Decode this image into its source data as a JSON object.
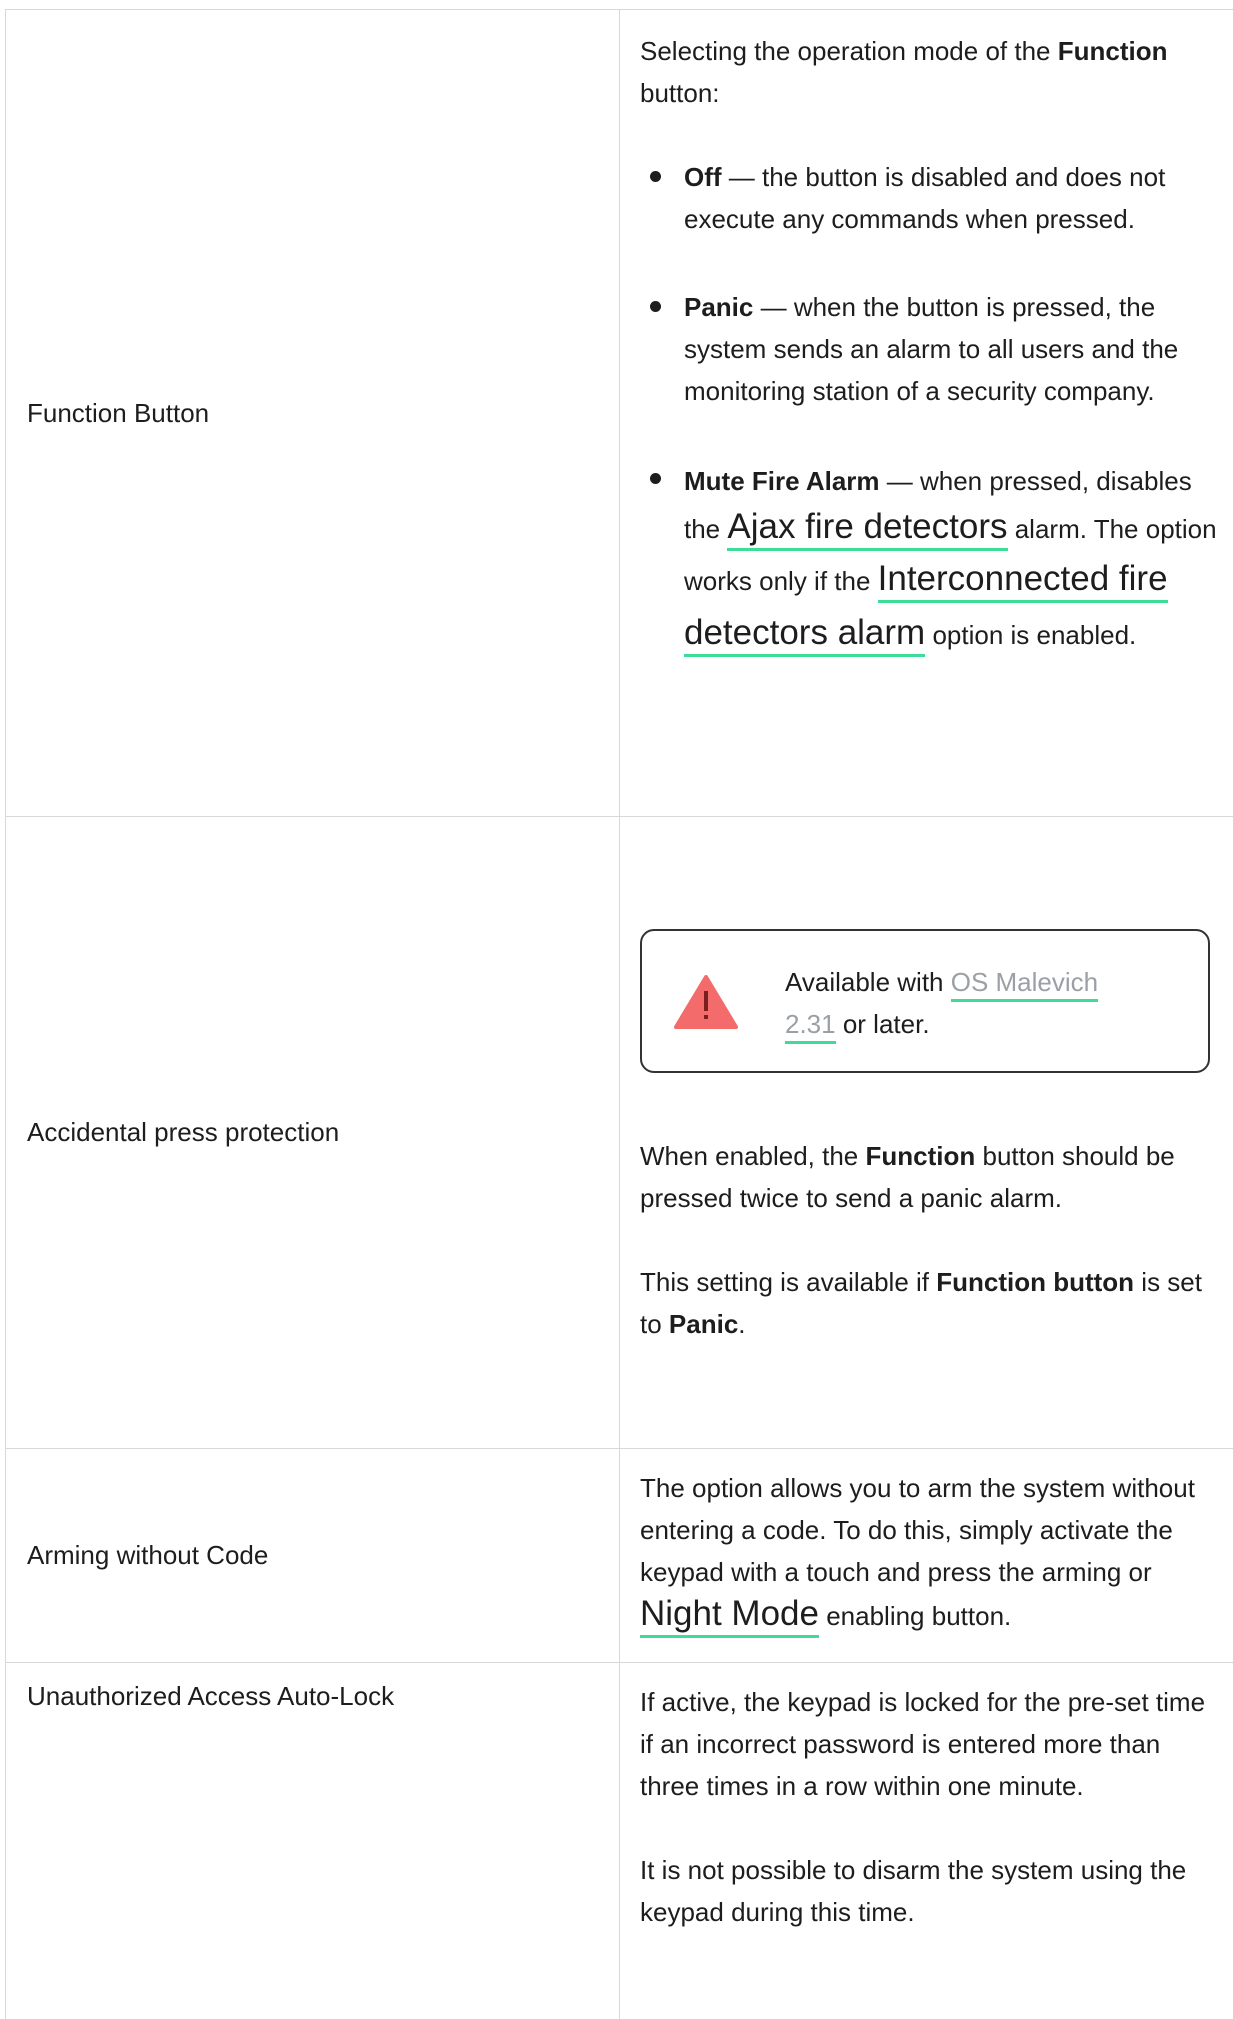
{
  "colors": {
    "accent": "#3ddc97",
    "warning": "#f46b6b",
    "border": "#d8d8d8"
  },
  "rows": [
    {
      "label": "Function Button",
      "intro_pre": "Selecting the operation mode of the ",
      "intro_bold": "Function",
      "intro_post": " button:",
      "bullets": [
        {
          "bold": "Off",
          "text": " — the button is disabled and does not execute any commands when pressed."
        },
        {
          "bold": "Panic",
          "text": " — when the button is pressed, the system sends an alarm to all users and the monitoring station of a security company."
        },
        {
          "bold": "Mute Fire Alarm",
          "text_a": " — when pressed, disables the ",
          "link1": "Ajax fire detectors",
          "text_b": " alarm. The option works only if the ",
          "link2": "Interconnected fire detectors alarm",
          "text_c": " option is enabled."
        }
      ]
    },
    {
      "label": "Accidental press protection",
      "callout": {
        "pre": "Available with ",
        "link": "OS Malevich 2.31",
        "post": " or later.",
        "icon": "warning-triangle-icon"
      },
      "p1_pre": "When enabled, the ",
      "p1_bold": "Function",
      "p1_post": " button should be pressed twice to send a panic alarm.",
      "p2_pre": "This setting is available if ",
      "p2_bold": "Function button",
      "p2_mid": " is set to ",
      "p2_bold2": "Panic",
      "p2_post": "."
    },
    {
      "label": "Arming without Code",
      "pre": "The option allows you to arm the system without entering a code. To do this, simply activate the keypad with a touch and press the arming or ",
      "link": "Night Mode",
      "post": " enabling button."
    },
    {
      "label": "Unauthorized Access Auto-Lock",
      "p1": "If active, the keypad is locked for the pre-set time if an incorrect password is entered more than three times in a row within one minute.",
      "p2": "It is not possible to disarm the system using the keypad during this time."
    }
  ]
}
